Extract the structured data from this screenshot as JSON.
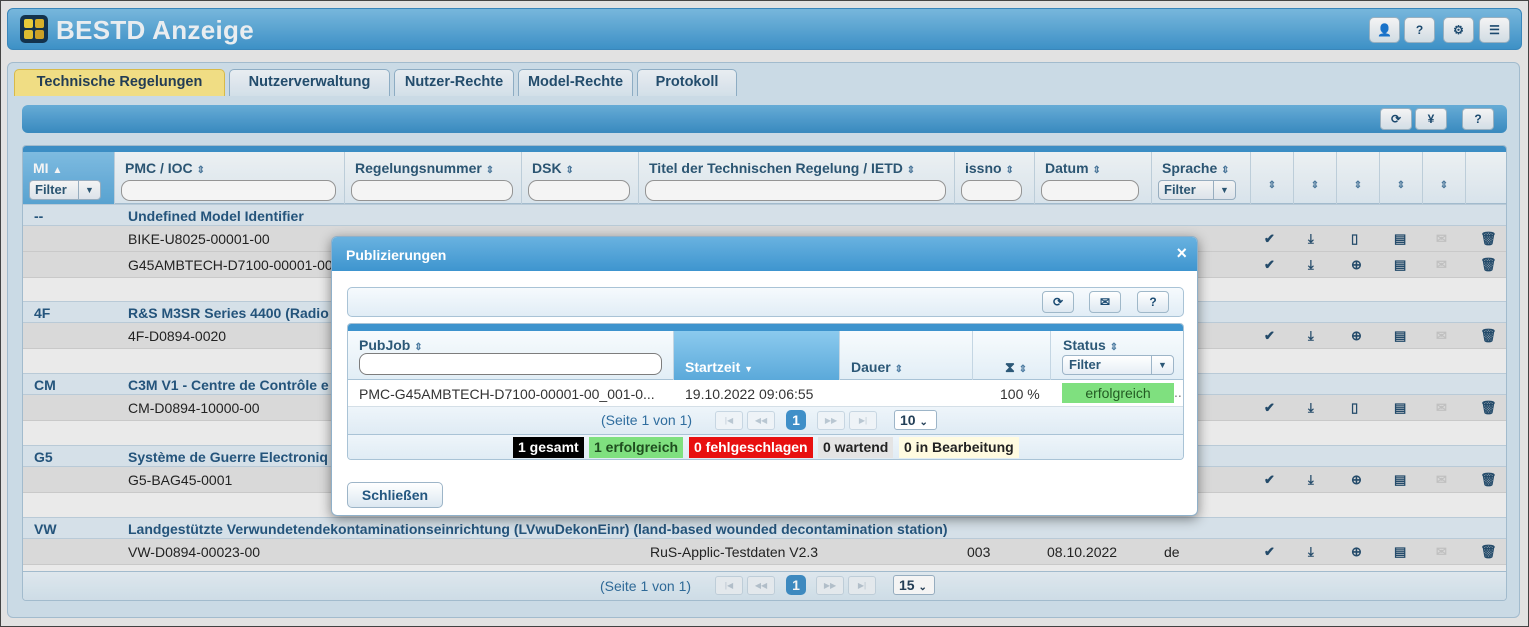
{
  "app": {
    "title": "BESTD Anzeige"
  },
  "topbar_icons": [
    "user-icon",
    "help-icon",
    "gear-icon",
    "menu-icon"
  ],
  "tabs": [
    {
      "label": "Technische Regelungen",
      "active": true
    },
    {
      "label": "Nutzerverwaltung",
      "active": false
    },
    {
      "label": "Nutzer-Rechte",
      "active": false
    },
    {
      "label": "Model-Rechte",
      "active": false
    },
    {
      "label": "Protokoll",
      "active": false
    }
  ],
  "toolbar": {
    "refresh": "⟳",
    "currency": "¥",
    "help": "?"
  },
  "grid": {
    "columns": {
      "mi": "MI",
      "pmc": "PMC / IOC",
      "regnr": "Regelungsnummer",
      "dsk": "DSK",
      "titel": "Titel der Technischen Regelung / IETD",
      "issno": "issno",
      "datum": "Datum",
      "sprache": "Sprache"
    },
    "filter_label": "Filter",
    "groups": [
      {
        "code": "--",
        "name": "Undefined Model Identifier"
      },
      {
        "code": "4F",
        "name": "R&S M3SR Series 4400 (Radio"
      },
      {
        "code": "CM",
        "name": "C3M V1 - Centre de Contrôle e"
      },
      {
        "code": "G5",
        "name": "Système de Guerre Electroniq"
      },
      {
        "code": "VW",
        "name": "Landgestützte Verwundetendekontaminationseinrichtung (LVwuDekonEinr) (land-based wounded decontamination station)"
      }
    ],
    "rows": [
      {
        "pmc": "BIKE-U8025-00001-00"
      },
      {
        "pmc": "G45AMBTECH-D7100-00001-00"
      },
      {
        "pmc": "4F-D0894-0020"
      },
      {
        "pmc": "CM-D0894-10000-00"
      },
      {
        "pmc": "G5-BAG45-0001"
      },
      {
        "pmc": "VW-D0894-00023-00",
        "titel": "RuS-Applic-Testdaten V2.3",
        "issno": "003",
        "datum": "08.10.2022",
        "sprache": "de"
      }
    ],
    "pager": {
      "info": "(Seite 1 von 1)",
      "page": "1",
      "page_size": "15"
    }
  },
  "dialog": {
    "title": "Publizierungen",
    "close_x": "×",
    "columns": {
      "pubjob": "PubJob",
      "startzeit": "Startzeit",
      "dauer": "Dauer",
      "status": "Status"
    },
    "status_filter": "Filter",
    "row": {
      "pubjob": "PMC-G45AMBTECH-D7100-00001-00_001-0...",
      "startzeit": "19.10.2022 09:06:55",
      "dauer": "",
      "progress": "100 %",
      "status": "erfolgreich"
    },
    "pager": {
      "info": "(Seite 1 von 1)",
      "page": "1",
      "page_size": "10"
    },
    "summary": {
      "gesamt": "1 gesamt",
      "erfolgreich": "1 erfolgreich",
      "fehlgeschlagen": "0 fehlgeschlagen",
      "wartend": "0 wartend",
      "bearbeitung": "0 in Bearbeitung"
    },
    "close_button": "Schließen"
  },
  "colors": {
    "accent": "#3d93cd",
    "active_tab": "#fbe78a",
    "success": "#7fe07f",
    "error": "#e81010"
  }
}
